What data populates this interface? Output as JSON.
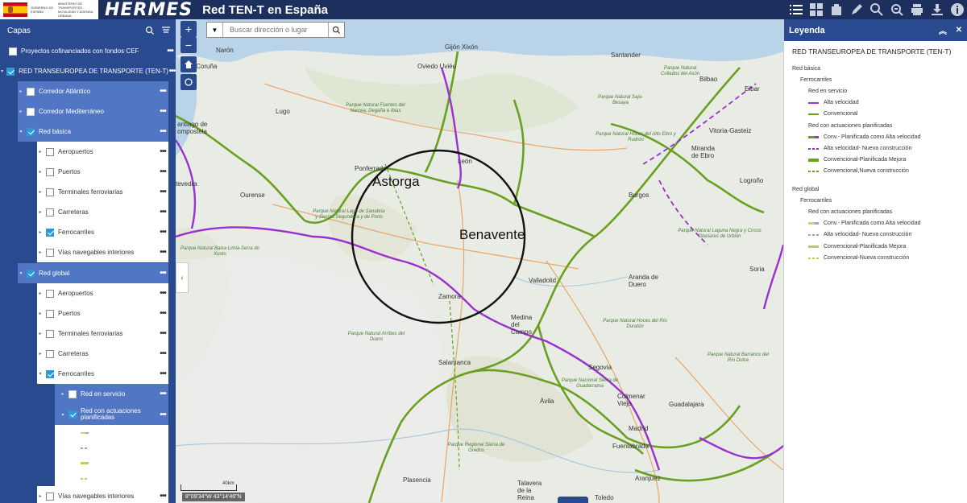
{
  "header": {
    "gov_text_1": "GOBIERNO DE ESPAÑA",
    "gov_text_2": "MINISTERIO DE TRANSPORTES, MOVILIDAD Y AGENDA URBANA",
    "brand": "HERMES",
    "title": "Red TEN-T en España"
  },
  "toolbar": {
    "tools": [
      "list-icon",
      "grid-icon",
      "briefcase-icon",
      "pencil-icon",
      "search-settings-icon",
      "zoom-icon",
      "print-icon",
      "download-icon",
      "info-icon"
    ]
  },
  "layers": {
    "title": "Capas",
    "items": [
      {
        "label": "Proyectos cofinanciados con fondos CEF",
        "checked": false
      },
      {
        "label": "RED TRANSEUROPEA DE TRANSPORTE (TEN-T)",
        "checked": true
      },
      {
        "label": "Corredor Atlántico",
        "checked": false
      },
      {
        "label": "Corredor Mediterráneo",
        "checked": false
      },
      {
        "label": "Red básica",
        "checked": true
      },
      {
        "label": "Aeropuertos",
        "checked": false
      },
      {
        "label": "Puertos",
        "checked": false
      },
      {
        "label": "Terminales ferroviarias",
        "checked": false
      },
      {
        "label": "Carreteras",
        "checked": false
      },
      {
        "label": "Ferrocarriles",
        "checked": true
      },
      {
        "label": "Vías navegables interiores",
        "checked": false
      },
      {
        "label": "Red global",
        "checked": true
      },
      {
        "label": "Aeropuertos",
        "checked": false
      },
      {
        "label": "Puertos",
        "checked": false
      },
      {
        "label": "Terminales ferroviarias",
        "checked": false
      },
      {
        "label": "Carreteras",
        "checked": false
      },
      {
        "label": "Ferrocarriles",
        "checked": true
      },
      {
        "label": "Red en servicio",
        "checked": false
      },
      {
        "label": "Red con actuaciones planificadas",
        "checked": true
      },
      {
        "label": "Vías navegables interiores",
        "checked": false
      }
    ]
  },
  "map": {
    "search_placeholder": "Buscar dirección o lugar",
    "scale_label": "40km",
    "coords": "8°09'34\"W 43°14'46\"N",
    "annotations": [
      "Astorga",
      "Benavente"
    ],
    "cities": [
      "Narón",
      "A Coruña",
      "Oviedo Uviéu",
      "Gijón Xixón",
      "Santander",
      "Bilbao",
      "Eibar",
      "Lugo",
      "antiago de ompostela",
      "Vitoria-Gasteiz",
      "Miranda de Ebro",
      "Logroño",
      "tevedra",
      "Ponferrada",
      "León",
      "Ourense",
      "Burgos",
      "Soria",
      "Valladolid",
      "Aranda de Duero",
      "Zamora",
      "Medina del Campo",
      "Salamanca",
      "Segovia",
      "Ávila",
      "Colmenar Viejo",
      "Guadalajara",
      "Madrid",
      "Fuenlabrada",
      "Plasencia",
      "Talavera de la Reina",
      "Aranjuez",
      "Toledo"
    ],
    "parks": [
      "Parque Natural Fuentes del Narcea, Degaña e Ibias",
      "Parque Natural Hoces del Alto Ebro y Rudrón",
      "Parque Natural Lago de Sanabria y Sierras Segundera y de Porto",
      "Parque Natural Laguna Negra y Circos Glaciares de Urbión",
      "Parque Natural Baixa Limia-Serra do Xurés",
      "Parque Natural Arribes del Duero",
      "Parque Natural Hoces del Río Duratón",
      "Parque Nacional Sierra de Guadarrama",
      "Parque Regional Sierra de Gredos",
      "Parque Natural Barranco del Río Dulce",
      "Parque Natural Saja-Besaya",
      "Parque Natural Collados del Asón"
    ]
  },
  "legend": {
    "title": "Leyenda",
    "root": "RED TRANSEUROPEA DE TRANSPORTE (TEN-T)",
    "basic": "Red básica",
    "rail": "Ferrocarriles",
    "in_service": "Red en servicio",
    "planned": "Red con actuaciones planificadas",
    "global": "Red global",
    "rail_global": "Ferrocarriles",
    "planned_global": "Red con actuaciones planificadas",
    "items": [
      {
        "label": "Alta velocidad",
        "color": "#9b30d0",
        "style": "solid"
      },
      {
        "label": "Convencional",
        "color": "#6aa020",
        "style": "solid"
      },
      {
        "label": "Conv.- Planificada como Alta velocidad",
        "color": "#6aa020",
        "style": "dash-purple"
      },
      {
        "label": "Alta velocidad- Nueva construcción",
        "color": "#9b30d0",
        "style": "dashed"
      },
      {
        "label": "Convencional-Planificada Mejora",
        "color": "#6aa020",
        "style": "thick"
      },
      {
        "label": "Convencional,Nueva construcción",
        "color": "#6aa020",
        "style": "dashed"
      },
      {
        "label": "Conv.- Planificada como Alta velocidad",
        "color": "#c4d67a",
        "style": "dash-purple"
      },
      {
        "label": "Alta velocidad- Nueva construcción",
        "color": "#c090e0",
        "style": "dashed"
      },
      {
        "label": "Convencional-Planificada Mejora",
        "color": "#b6d060",
        "style": "thick"
      },
      {
        "label": "Convencional-Nueva construcción",
        "color": "#b6d060",
        "style": "dashed"
      }
    ]
  }
}
